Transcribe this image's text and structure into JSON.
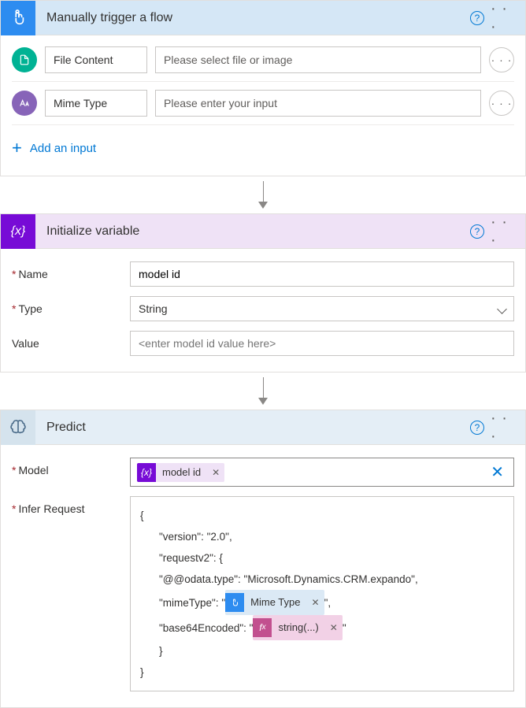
{
  "trigger": {
    "title": "Manually trigger a flow",
    "fileContent": {
      "label": "File Content",
      "placeholder": "Please select file or image"
    },
    "mimeType": {
      "label": "Mime Type",
      "placeholder": "Please enter your input"
    },
    "addInput": "Add an input"
  },
  "variable": {
    "title": "Initialize variable",
    "nameLabel": "Name",
    "nameValue": "model id",
    "typeLabel": "Type",
    "typeValue": "String",
    "valueLabel": "Value",
    "valuePlaceholder": "<enter model id value here>"
  },
  "predict": {
    "title": "Predict",
    "modelLabel": "Model",
    "modelToken": "model id",
    "inferLabel": "Infer Request",
    "code": {
      "l1": "{",
      "l2": "\"version\": \"2.0\",",
      "l3": "\"requestv2\": {",
      "l4": "\"@@odata.type\": \"Microsoft.Dynamics.CRM.expando\",",
      "l5a": "\"mimeType\": \" ",
      "l5token": "Mime Type",
      "l5b": " \",",
      "l6a": "\"base64Encoded\": \" ",
      "l6token": "string(...)",
      "l6b": " \"",
      "l7": "}",
      "l8": "}"
    }
  }
}
